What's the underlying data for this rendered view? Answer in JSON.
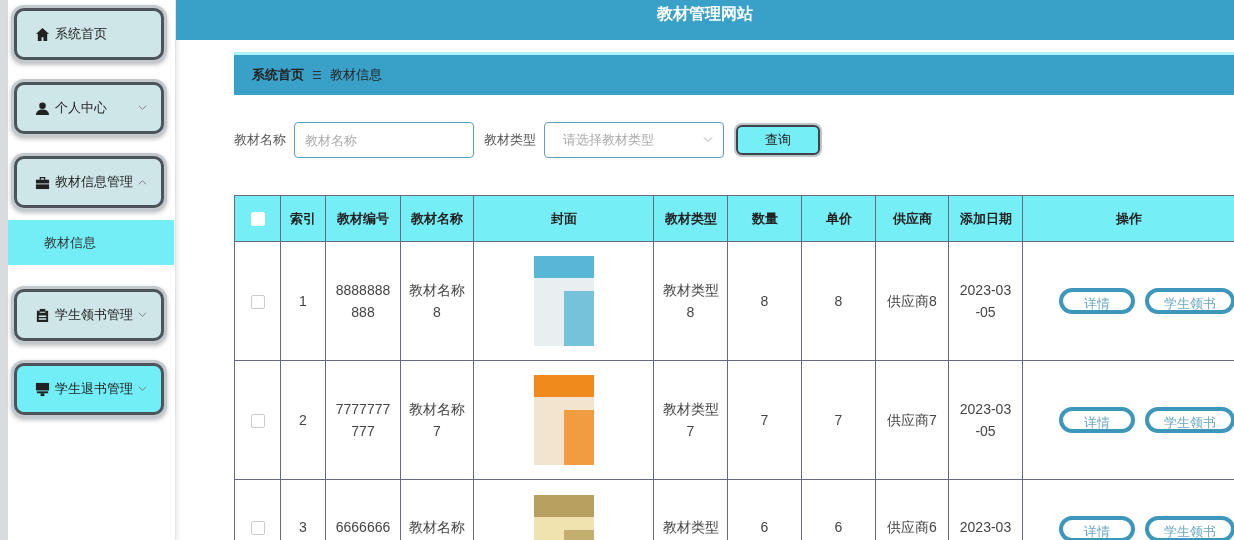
{
  "header": {
    "title": "教材管理网站"
  },
  "sidebar": {
    "items": [
      {
        "kind": "link",
        "label": "系统首页",
        "hovered": false
      },
      {
        "kind": "group",
        "label": "个人中心",
        "expanded": false,
        "hovered": false
      },
      {
        "kind": "group",
        "label": "教材信息管理",
        "expanded": true,
        "hovered": false,
        "children": [
          {
            "label": "教材信息",
            "selected": true
          }
        ]
      },
      {
        "kind": "group",
        "label": "学生领书管理",
        "expanded": false,
        "hovered": false
      },
      {
        "kind": "group",
        "label": "学生退书管理",
        "expanded": false,
        "hovered": true
      }
    ]
  },
  "breadcrumb": {
    "home": "系统首页",
    "separator": "☰",
    "current": "教材信息"
  },
  "search": {
    "fields": [
      {
        "kind": "text",
        "label": "教材名称",
        "placeholder": "教材名称"
      },
      {
        "kind": "select",
        "label": "教材类型",
        "placeholder": "请选择教材类型"
      }
    ],
    "button": "查询"
  },
  "table": {
    "header_checked": false,
    "columns": [
      "索引",
      "教材编号",
      "教材名称",
      "封面",
      "教材类型",
      "数量",
      "单价",
      "供应商",
      "添加日期",
      "操作"
    ],
    "rows": [
      {
        "checked": false,
        "index": "1",
        "code": "8888888888",
        "name": "教材名称8",
        "type": "教材类型8",
        "quantity": "8",
        "price": "8",
        "supplier": "供应商8",
        "date": "2023-03-05",
        "actions": [
          "详情",
          "学生领书"
        ]
      },
      {
        "checked": false,
        "index": "2",
        "code": "7777777777",
        "name": "教材名称7",
        "type": "教材类型7",
        "quantity": "7",
        "price": "7",
        "supplier": "供应商7",
        "date": "2023-03-05",
        "actions": [
          "详情",
          "学生领书"
        ]
      },
      {
        "checked": false,
        "index": "3",
        "code": "6666666",
        "name": "教材名称",
        "type": "教材类型",
        "quantity": "6",
        "price": "6",
        "supplier": "供应商6",
        "date": "2023-03",
        "actions": [
          "详情",
          "学生领书"
        ]
      }
    ]
  }
}
